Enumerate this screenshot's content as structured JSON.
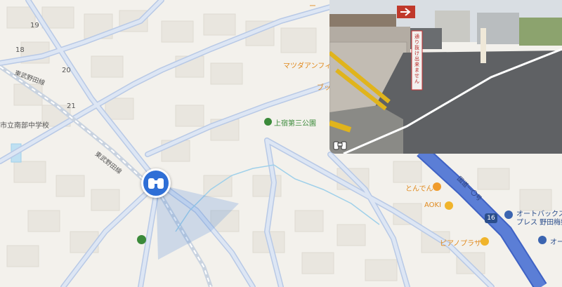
{
  "map": {
    "block_numbers": [
      "19",
      "18",
      "20",
      "21"
    ],
    "area_labels": {
      "school_partial": "市立南部中学校",
      "road_tobu_noda_line": "東武野田線",
      "road_tobu_noda_line_2": "東武野田線",
      "route_number": "国道一〇号"
    },
    "pois": {
      "mazda": "マツダアンフィ",
      "mazda_cut": "ブッ",
      "park": "上宿第三公園",
      "tonden": "とんでん",
      "aoki": "AOKI",
      "autobacs_line1": "オートバックス",
      "autobacs_line2": "プレス 野田梅郷",
      "piano_plaza": "ピアノプラザ",
      "edge_label": "オー",
      "top_cut": "ー"
    },
    "route_shield": "16",
    "colors": {
      "base": "#f3f1ec",
      "road": "#dde6f4",
      "road_stroke": "#b8c9e6",
      "highway": "#5b7ed6",
      "water": "#9fd0ea",
      "park_green": "#3b8a3a",
      "poi_orange": "#e08a1e",
      "marker_blue": "#2f6fd6"
    }
  },
  "streetview": {
    "sign_text": "通り抜け出来ません",
    "icons": [
      "arrow-sign-icon",
      "binoculars-icon"
    ]
  },
  "marker": {
    "icon": "binoculars-icon"
  }
}
